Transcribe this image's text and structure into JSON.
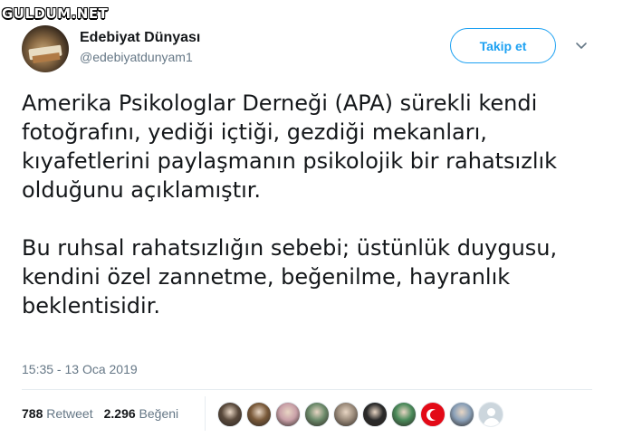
{
  "watermark": "GULDUM.NET",
  "author": {
    "name": "Edebiyat Dünyası",
    "handle": "@edebiyatdunyam1"
  },
  "follow_label": "Takip et",
  "tweet": {
    "paragraph1": "Amerika Psikologlar Derneği (APA) sürekli kendi fotoğrafını, yediği içtiği, gezdiği mekanları, kıyafetlerini paylaşmanın psikolojik bir rahatsızlık olduğunu açıklamıştır.",
    "paragraph2": "Bu ruhsal rahatsızlığın sebebi; üstünlük duygusu, kendini özel zannetme, beğenilme, hayranlık beklentisidir."
  },
  "timestamp": "15:35 - 13 Oca 2019",
  "stats": {
    "retweet_count": "788",
    "retweet_label": "Retweet",
    "like_count": "2.296",
    "like_label": "Beğeni"
  },
  "likers": [
    {
      "color": "#5a4a3c"
    },
    {
      "color": "#7a5a3a"
    },
    {
      "color": "#c9a0a8"
    },
    {
      "color": "#6b8a6a"
    },
    {
      "color": "#9a8a7a"
    },
    {
      "color": "#2a2a2a"
    },
    {
      "color": "#4a8a5a"
    },
    {
      "color": "#e30a17"
    },
    {
      "color": "#8aa0b8"
    },
    {
      "color": "#ccd6dd"
    }
  ]
}
